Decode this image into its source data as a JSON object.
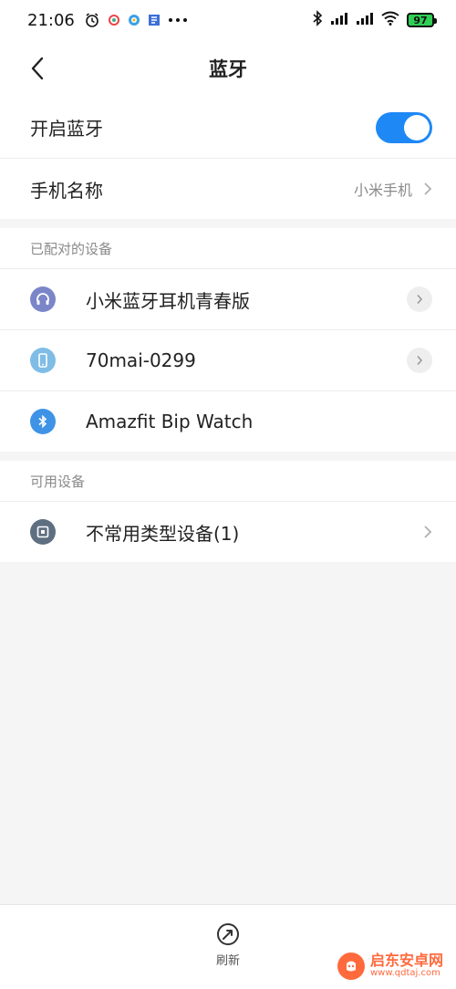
{
  "status_bar": {
    "time": "21:06",
    "battery": "97",
    "icons": [
      "alarm-icon",
      "app-notification-icon",
      "app-notification-icon",
      "app-notification-icon",
      "more-dots-icon",
      "bluetooth-icon",
      "signal-icon",
      "signal-icon",
      "wifi-icon",
      "battery-icon"
    ]
  },
  "header": {
    "title": "蓝牙",
    "back_icon": "back-arrow-icon"
  },
  "settings": {
    "bluetooth_toggle": {
      "label": "开启蓝牙",
      "enabled": true
    },
    "phone_name": {
      "label": "手机名称",
      "value": "小米手机"
    }
  },
  "paired": {
    "header": "已配对的设备",
    "devices": [
      {
        "name": "小米蓝牙耳机青春版",
        "icon": "headphones-icon",
        "icon_color": "#7b86c9"
      },
      {
        "name": "70mai-0299",
        "icon": "phone-device-icon",
        "icon_color": "#7fbde6"
      },
      {
        "name": "Amazfit Bip Watch",
        "icon": "bluetooth-icon",
        "icon_color": "#3f93e6"
      }
    ]
  },
  "available": {
    "header": "可用设备",
    "devices": [
      {
        "name": "不常用类型设备(1)",
        "icon": "generic-device-icon",
        "icon_color": "#5f6f82"
      }
    ]
  },
  "bottom": {
    "refresh_label": "刷新"
  },
  "watermark": {
    "title": "启东安卓网",
    "url": "www.qdtaj.com"
  },
  "colors": {
    "accent": "#1e88f5",
    "background": "#f5f5f5"
  }
}
